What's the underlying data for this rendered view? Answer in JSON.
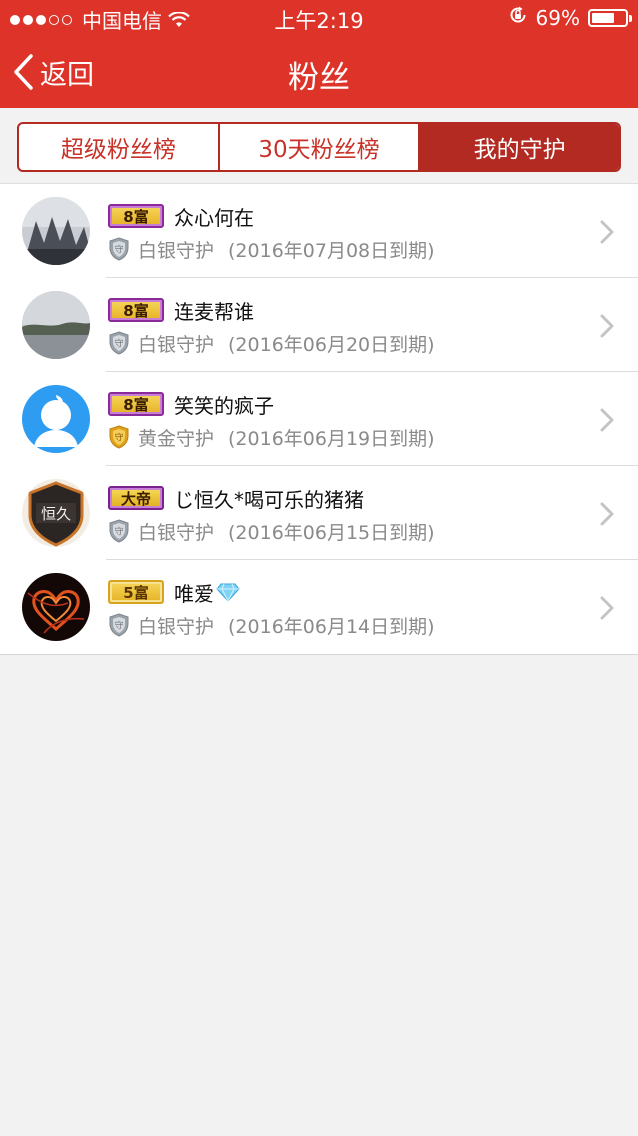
{
  "status_bar": {
    "carrier": "中国电信",
    "time": "上午2:19",
    "battery": "69%",
    "battery_level": 0.69
  },
  "nav": {
    "back_label": "返回",
    "title": "粉丝"
  },
  "tabs": [
    {
      "label": "超级粉丝榜",
      "active": false
    },
    {
      "label": "30天粉丝榜",
      "active": false
    },
    {
      "label": "我的守护",
      "active": true
    }
  ],
  "colors": {
    "header_red": "#de3328",
    "tab_active": "#b22a22",
    "silver_guard": "#9aa3ab",
    "gold_guard": "#e0a21c"
  },
  "fans": [
    {
      "badge": "8富",
      "name": "众心何在",
      "guard_type": "白银守护",
      "expiry": "(2016年07月08日到期)",
      "guard_icon": "silver-guard-icon"
    },
    {
      "badge": "8富",
      "name": "连麦帮谁",
      "guard_type": "白银守护",
      "expiry": "(2016年06月20日到期)",
      "guard_icon": "silver-guard-icon"
    },
    {
      "badge": "8富",
      "name": "笑笑的疯子",
      "guard_type": "黄金守护",
      "expiry": "(2016年06月19日到期)",
      "guard_icon": "gold-guard-icon"
    },
    {
      "badge": "大帝",
      "name": "じ恒久*喝可乐的猪猪",
      "guard_type": "白银守护",
      "expiry": "(2016年06月15日到期)",
      "guard_icon": "silver-guard-icon",
      "avatar_text": "恒久"
    },
    {
      "badge": "5富",
      "name": "唯爱",
      "guard_type": "白银守护",
      "expiry": "(2016年06月14日到期)",
      "guard_icon": "silver-guard-icon",
      "name_icon": "diamond-icon"
    }
  ]
}
